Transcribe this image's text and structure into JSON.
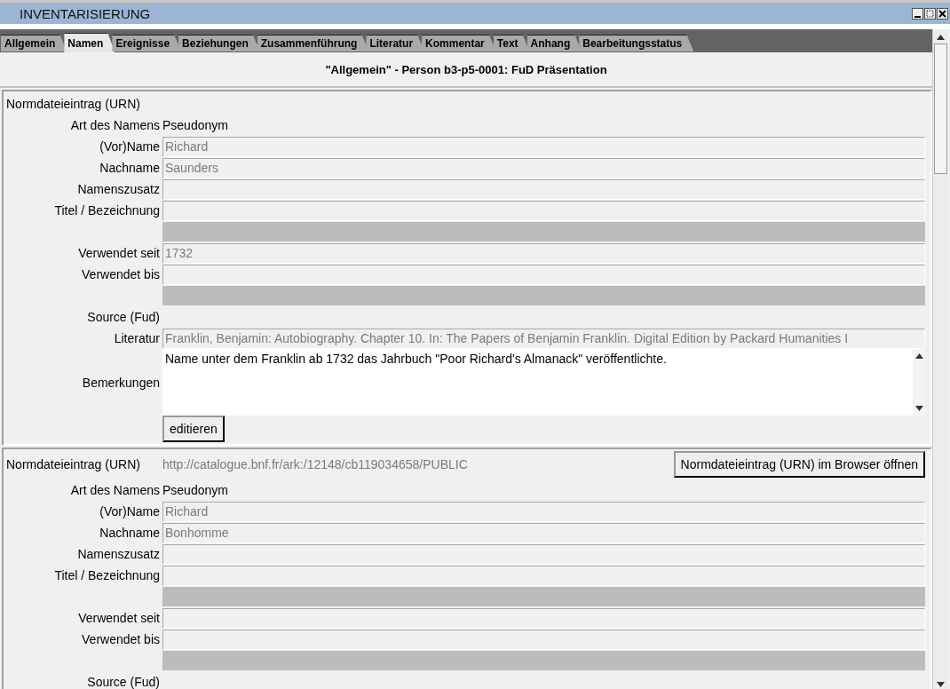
{
  "window": {
    "title": "INVENTARISIERUNG"
  },
  "tabs": [
    {
      "label": "Allgemein",
      "selected": false
    },
    {
      "label": "Namen",
      "selected": true
    },
    {
      "label": "Ereignisse",
      "selected": false
    },
    {
      "label": "Beziehungen",
      "selected": false
    },
    {
      "label": "Zusammenführung",
      "selected": false
    },
    {
      "label": "Literatur",
      "selected": false
    },
    {
      "label": "Kommentar",
      "selected": false
    },
    {
      "label": "Text",
      "selected": false
    },
    {
      "label": "Anhang",
      "selected": false
    },
    {
      "label": "Bearbeitungsstatus",
      "selected": false
    }
  ],
  "heading": "\"Allgemein\" - Person b3-p5-0001: FuD Präsentation",
  "records": [
    {
      "rows": [
        {
          "kind": "urn",
          "label": "Normdateieintrag (URN)"
        },
        {
          "kind": "static",
          "label": "Art des Namens",
          "value": "Pseudonym"
        },
        {
          "kind": "field",
          "label": "(Vor)Name",
          "value": "Richard"
        },
        {
          "kind": "field",
          "label": "Nachname",
          "value": "Saunders"
        },
        {
          "kind": "field",
          "label": "Namenszusatz"
        },
        {
          "kind": "field",
          "label": "Titel / Bezeichnung"
        },
        {
          "kind": "gap"
        },
        {
          "kind": "field",
          "label": "Verwendet seit",
          "value": "1732"
        },
        {
          "kind": "field",
          "label": "Verwendet bis"
        },
        {
          "kind": "gap"
        },
        {
          "kind": "static",
          "label": "Source (Fud)"
        },
        {
          "kind": "field",
          "label": "Literatur",
          "value": "Franklin, Benjamin: Autobiography. Chapter 10. In: The Papers of Benjamin Franklin. Digital Edition by Packard Humanities I"
        },
        {
          "kind": "textarea",
          "label": "Bemerkungen",
          "value": "Name unter dem Franklin ab 1732 das Jahrbuch \"Poor Richard's Almanack\" veröffentlichte."
        },
        {
          "kind": "button",
          "label": "editieren"
        }
      ]
    },
    {
      "rows": [
        {
          "kind": "urn",
          "label": "Normdateieintrag (URN)",
          "value": "http://catalogue.bnf.fr/ark:/12148/cb119034658/PUBLIC",
          "button": "Normdateieintrag (URN) im Browser öffnen"
        },
        {
          "kind": "static",
          "label": "Art des Namens",
          "value": "Pseudonym"
        },
        {
          "kind": "field",
          "label": "(Vor)Name",
          "value": "Richard"
        },
        {
          "kind": "field",
          "label": "Nachname",
          "value": "Bonhomme"
        },
        {
          "kind": "field",
          "label": "Namenszusatz"
        },
        {
          "kind": "field",
          "label": "Titel / Bezeichnung"
        },
        {
          "kind": "gap"
        },
        {
          "kind": "field",
          "label": "Verwendet seit"
        },
        {
          "kind": "field",
          "label": "Verwendet bis"
        },
        {
          "kind": "gap"
        },
        {
          "kind": "static",
          "label": "Source (Fud)"
        }
      ]
    }
  ]
}
